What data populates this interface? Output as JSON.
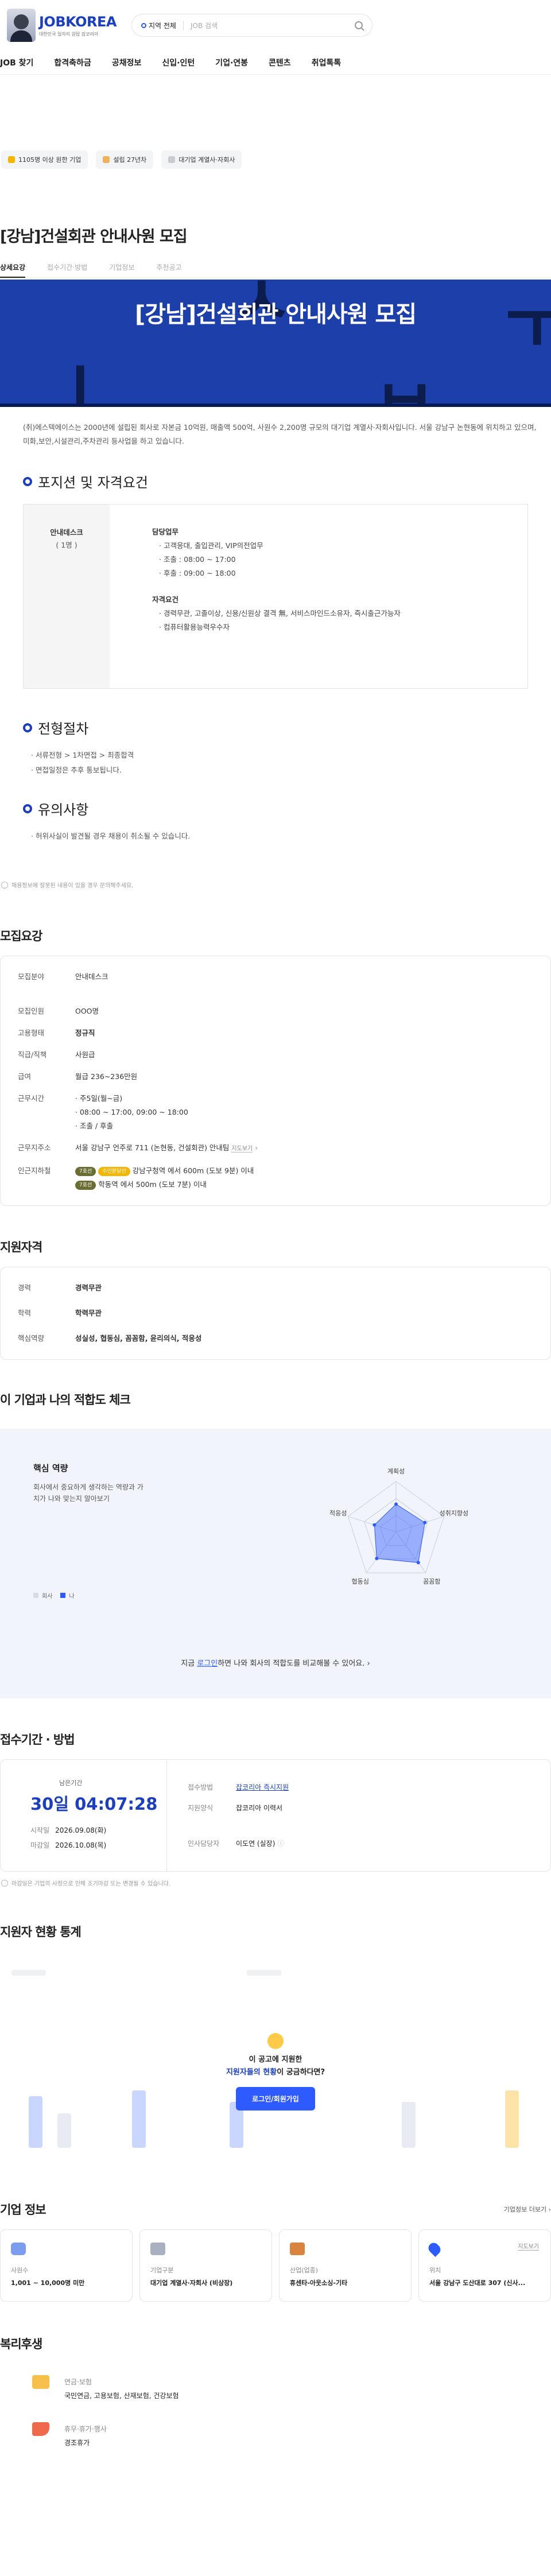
{
  "header": {
    "logo": "JOBKOREA",
    "logo_sub": "대한민국 일자리 원탑 잡코리아",
    "region": "지역 전체",
    "search_placeholder": "JOB 검색",
    "nav": [
      "JOB 찾기",
      "합격축하금",
      "공채정보",
      "신입·인턴",
      "기업·연봉",
      "콘텐츠",
      "취업톡톡"
    ]
  },
  "chips": [
    "1105명 이상 원한 기업",
    "설립 27년차",
    "대기업 계열사·자회사"
  ],
  "job": {
    "title": "[강남]건설회관 안내사원 모집",
    "tabs": [
      "상세요강",
      "접수기간·방법",
      "기업정보",
      "추천공고"
    ],
    "banner_title": "[강남]건설회관 안내사원 모집",
    "intro": "(취)에스텍에이스는 2000년에 설립된 회사로 자본금 10억원, 매출액 500억, 사원수 2,200명 규모의 대기업 계열사·자회사입니다. 서울 강남구 논현동에 위치하고 있으며, 미화,보안,시설관리,주차관리 등사업을 하고 있습니다."
  },
  "position": {
    "heading": "포지션 및 자격요건",
    "role": "안내데스크",
    "count": "( 1명 )",
    "duty_label": "담당업무",
    "duties": [
      "· 고객응대, 출입관리, VIP의전업무",
      "· 조출 : 08:00 ~ 17:00",
      "· 후출 : 09:00 ~ 18:00"
    ],
    "req_label": "자격요건",
    "reqs": [
      "· 경력무관, 고졸이상, 신용/신원상 결격 無, 서비스마인드소유자, 즉시출근가능자",
      "· 컴퓨터활용능력우수자"
    ]
  },
  "process": {
    "heading": "전형절차",
    "lines": [
      "· 서류전형 > 1차면접 > 최종합격",
      "· 면접일정은 추후 통보됩니다."
    ]
  },
  "caution": {
    "heading": "유의사항",
    "lines": [
      "· 허위사실이 발견될 경우 채용이 취소될 수 있습니다."
    ]
  },
  "notice_text": "채용정보에 잘못된 내용이 있을 경우 문의해주세요.",
  "summary": {
    "heading": "모집요강",
    "rows": [
      {
        "k": "모집분야",
        "v": "안내데스크"
      },
      {
        "k": "모집인원",
        "v": "OOO명"
      },
      {
        "k": "고용형태",
        "v": "정규직"
      },
      {
        "k": "직급/직책",
        "v": "사원급"
      },
      {
        "k": "급여",
        "v": "월급 236~236만원"
      },
      {
        "k": "근무시간",
        "v": "· 주5일(월~금)"
      },
      {
        "k": "",
        "v": "· 08:00 ~ 17:00, 09:00 ~ 18:00"
      },
      {
        "k": "",
        "v": "· 조출 / 후출"
      }
    ],
    "workplace_label": "근무지주소",
    "workplace": "서울 강남구 언주로 711 (논현동, 건설회관) 안내팀",
    "map_link": "지도보기",
    "subway_label": "인근지하철",
    "subway1_tag1": "7호선",
    "subway1_tag2": "수인분당선",
    "subway1": "강남구청역 에서 600m (도보 9분) 이내",
    "subway2_tag1": "7호선",
    "subway2": "학동역 에서 500m (도보 7분) 이내"
  },
  "qualification": {
    "heading": "지원자격",
    "rows": [
      {
        "k": "경력",
        "v": "경력무관"
      },
      {
        "k": "학력",
        "v": "학력무관"
      }
    ],
    "skill_label": "핵심역량",
    "skills": "성실성, 협동심, 꼼꼼함, 윤리의식, 적응성"
  },
  "fit": {
    "heading": "이 기업과 나의 적합도 체크",
    "sub_heading": "핵심 역량",
    "desc": "회사에서 중요하게 생각하는 역량과 가치가 나와 맞는지 알아보기",
    "legend_company": "회사",
    "legend_me": "나",
    "axes": [
      "계획성",
      "성취지향성",
      "꼼꼼함",
      "협동심",
      "적응성"
    ],
    "company": [
      0.55,
      0.6,
      0.75,
      0.65,
      0.45
    ],
    "cta_pre": "지금",
    "cta_link": "로그인",
    "cta_post": "하면 나와 회사의 적합도를 비교해볼 수 있어요.",
    "accent": "#2e5bff"
  },
  "apply": {
    "heading": "접수기간 · 방법",
    "remain_label": "남은기간",
    "remain": "30일 04:07:28",
    "start_label": "시작일",
    "start": "2026.09.08(화)",
    "end_label": "마감일",
    "end": "2026.10.08(목)",
    "method_label": "접수방법",
    "method": "잡코리아 즉시지원",
    "form_label": "지원양식",
    "form": "잡코리아 이력서",
    "manager_label": "인사담당자",
    "manager": "이도연 (실장)",
    "note": "마감일은 기업의 사정으로 인해 조기마감 또는 변경될 수 있습니다."
  },
  "stats": {
    "heading": "지원자 현황 통계",
    "prompt1": "이 공고에 지원한",
    "prompt_hl": "지원자들의 현황",
    "prompt2": "이 궁금하다면?",
    "button": "로그인/회원가입"
  },
  "company": {
    "heading": "기업 정보",
    "more": "기업정보 더보기",
    "cards": [
      {
        "k": "사원수",
        "v": "1,001 ~ 10,000명 미만"
      },
      {
        "k": "기업구분",
        "v": "대기업 계열사·자회사 (비상장)"
      },
      {
        "k": "산업(업종)",
        "v": "휴센타-아웃소싱-기타"
      },
      {
        "k": "위치",
        "v": "서울 강남구 도산대로 307 (신사..."
      }
    ],
    "map_label": "지도보기"
  },
  "welfare": {
    "heading": "복리후생",
    "items": [
      {
        "k": "연금·보험",
        "v": "국민연금, 고용보험, 산재보험, 건강보험"
      },
      {
        "k": "휴무·휴가·행사",
        "v": "경조휴가"
      }
    ]
  }
}
